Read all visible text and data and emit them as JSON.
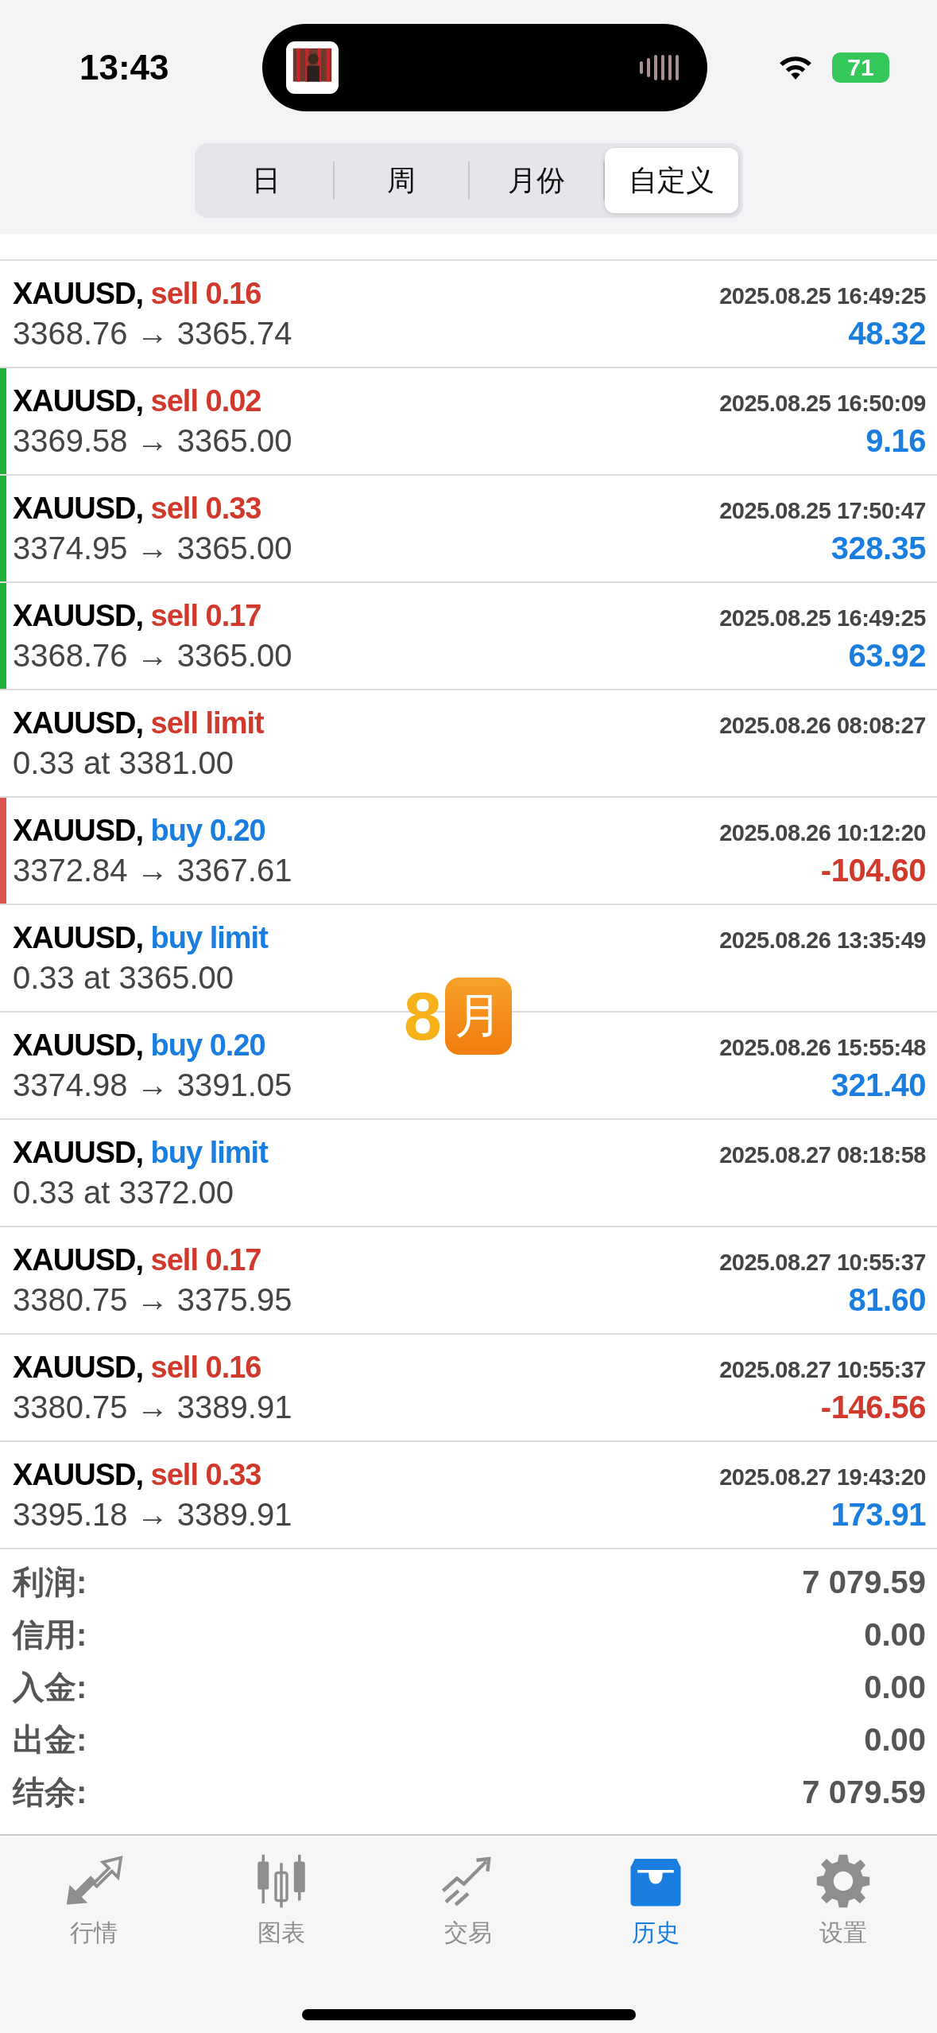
{
  "status_bar": {
    "time": "13:43",
    "battery": "71"
  },
  "tabs": [
    {
      "label": "日",
      "selected": false
    },
    {
      "label": "周",
      "selected": false
    },
    {
      "label": "月份",
      "selected": false
    },
    {
      "label": "自定义",
      "selected": true
    }
  ],
  "rows": [
    {
      "symbol": "XAUUSD,",
      "kind": "sell",
      "action": "sell 0.16",
      "time": "2025.08.25 16:49:25",
      "detail": "3368.76 → 3365.74",
      "profit": "48.32",
      "loss": false
    },
    {
      "symbol": "XAUUSD,",
      "kind": "sell",
      "action": "sell 0.02",
      "time": "2025.08.25 16:50:09",
      "detail": "3369.58 → 3365.00",
      "profit": "9.16",
      "loss": false,
      "color": "#22b03c"
    },
    {
      "symbol": "XAUUSD,",
      "kind": "sell",
      "action": "sell 0.33",
      "time": "2025.08.25 17:50:47",
      "detail": "3374.95 → 3365.00",
      "profit": "328.35",
      "loss": false,
      "color": "#22b03c"
    },
    {
      "symbol": "XAUUSD,",
      "kind": "sell",
      "action": "sell 0.17",
      "time": "2025.08.25 16:49:25",
      "detail": "3368.76 → 3365.00",
      "profit": "63.92",
      "loss": false,
      "color": "#22b03c"
    },
    {
      "symbol": "XAUUSD,",
      "kind": "sell",
      "action": "sell limit",
      "time": "2025.08.26 08:08:27",
      "detail": "0.33 at 3381.00"
    },
    {
      "symbol": "XAUUSD,",
      "kind": "buy",
      "action": "buy 0.20",
      "time": "2025.08.26 10:12:20",
      "detail": "3372.84 → 3367.61",
      "profit": "-104.60",
      "loss": true,
      "color": "#d9534f"
    },
    {
      "symbol": "XAUUSD,",
      "kind": "buy",
      "action": "buy limit",
      "time": "2025.08.26 13:35:49",
      "detail": "0.33 at 3365.00"
    },
    {
      "symbol": "XAUUSD,",
      "kind": "buy",
      "action": "buy 0.20",
      "time": "2025.08.26 15:55:48",
      "detail": "3374.98 → 3391.05",
      "profit": "321.40",
      "loss": false
    },
    {
      "symbol": "XAUUSD,",
      "kind": "buy",
      "action": "buy limit",
      "time": "2025.08.27 08:18:58",
      "detail": "0.33 at 3372.00"
    },
    {
      "symbol": "XAUUSD,",
      "kind": "sell",
      "action": "sell 0.17",
      "time": "2025.08.27 10:55:37",
      "detail": "3380.75 → 3375.95",
      "profit": "81.60",
      "loss": false
    },
    {
      "symbol": "XAUUSD,",
      "kind": "sell",
      "action": "sell 0.16",
      "time": "2025.08.27 10:55:37",
      "detail": "3380.75 → 3389.91",
      "profit": "-146.56",
      "loss": true
    },
    {
      "symbol": "XAUUSD,",
      "kind": "sell",
      "action": "sell 0.33",
      "time": "2025.08.27 19:43:20",
      "detail": "3395.18 → 3389.91",
      "profit": "173.91",
      "loss": false
    }
  ],
  "summary": [
    {
      "label": "利润:",
      "value": "7 079.59"
    },
    {
      "label": "信用:",
      "value": "0.00"
    },
    {
      "label": "入金:",
      "value": "0.00"
    },
    {
      "label": "出金:",
      "value": "0.00"
    },
    {
      "label": "结余:",
      "value": "7 079.59"
    }
  ],
  "sticker": {
    "number": "8",
    "unit": "月"
  },
  "tab_bar": [
    {
      "label": "行情",
      "kind": "quotes",
      "selected": false
    },
    {
      "label": "图表",
      "kind": "chart",
      "selected": false
    },
    {
      "label": "交易",
      "kind": "trade",
      "selected": false
    },
    {
      "label": "历史",
      "kind": "history",
      "selected": true
    },
    {
      "label": "设置",
      "kind": "settings",
      "selected": false
    }
  ]
}
